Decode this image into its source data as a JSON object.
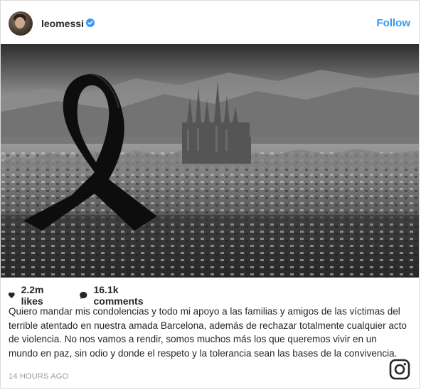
{
  "post": {
    "username": "leomessi",
    "follow_label": "Follow",
    "likes": "2.2m likes",
    "comments": "16.1k comments",
    "caption": "Quiero mandar mis condolencias y todo mi apoyo a las familias y amigos de las víctimas del terrible atentado en nuestra amada Barcelona, además de rechazar totalmente cualquier acto de violencia. No nos vamos a rendir, somos muchos más los que queremos vivir en un mundo en paz, sin odio y donde el respeto y la tolerancia sean las bases de la convivencia.",
    "timestamp": "14 HOURS AGO"
  },
  "icons": {
    "verified": "verified-badge-icon",
    "like": "heart-icon",
    "comment": "comment-bubble-icon",
    "brand": "instagram-logo-icon"
  },
  "colors": {
    "accent": "#3897f0",
    "text": "#262626",
    "muted": "#999999",
    "border": "#dbdbdb"
  }
}
